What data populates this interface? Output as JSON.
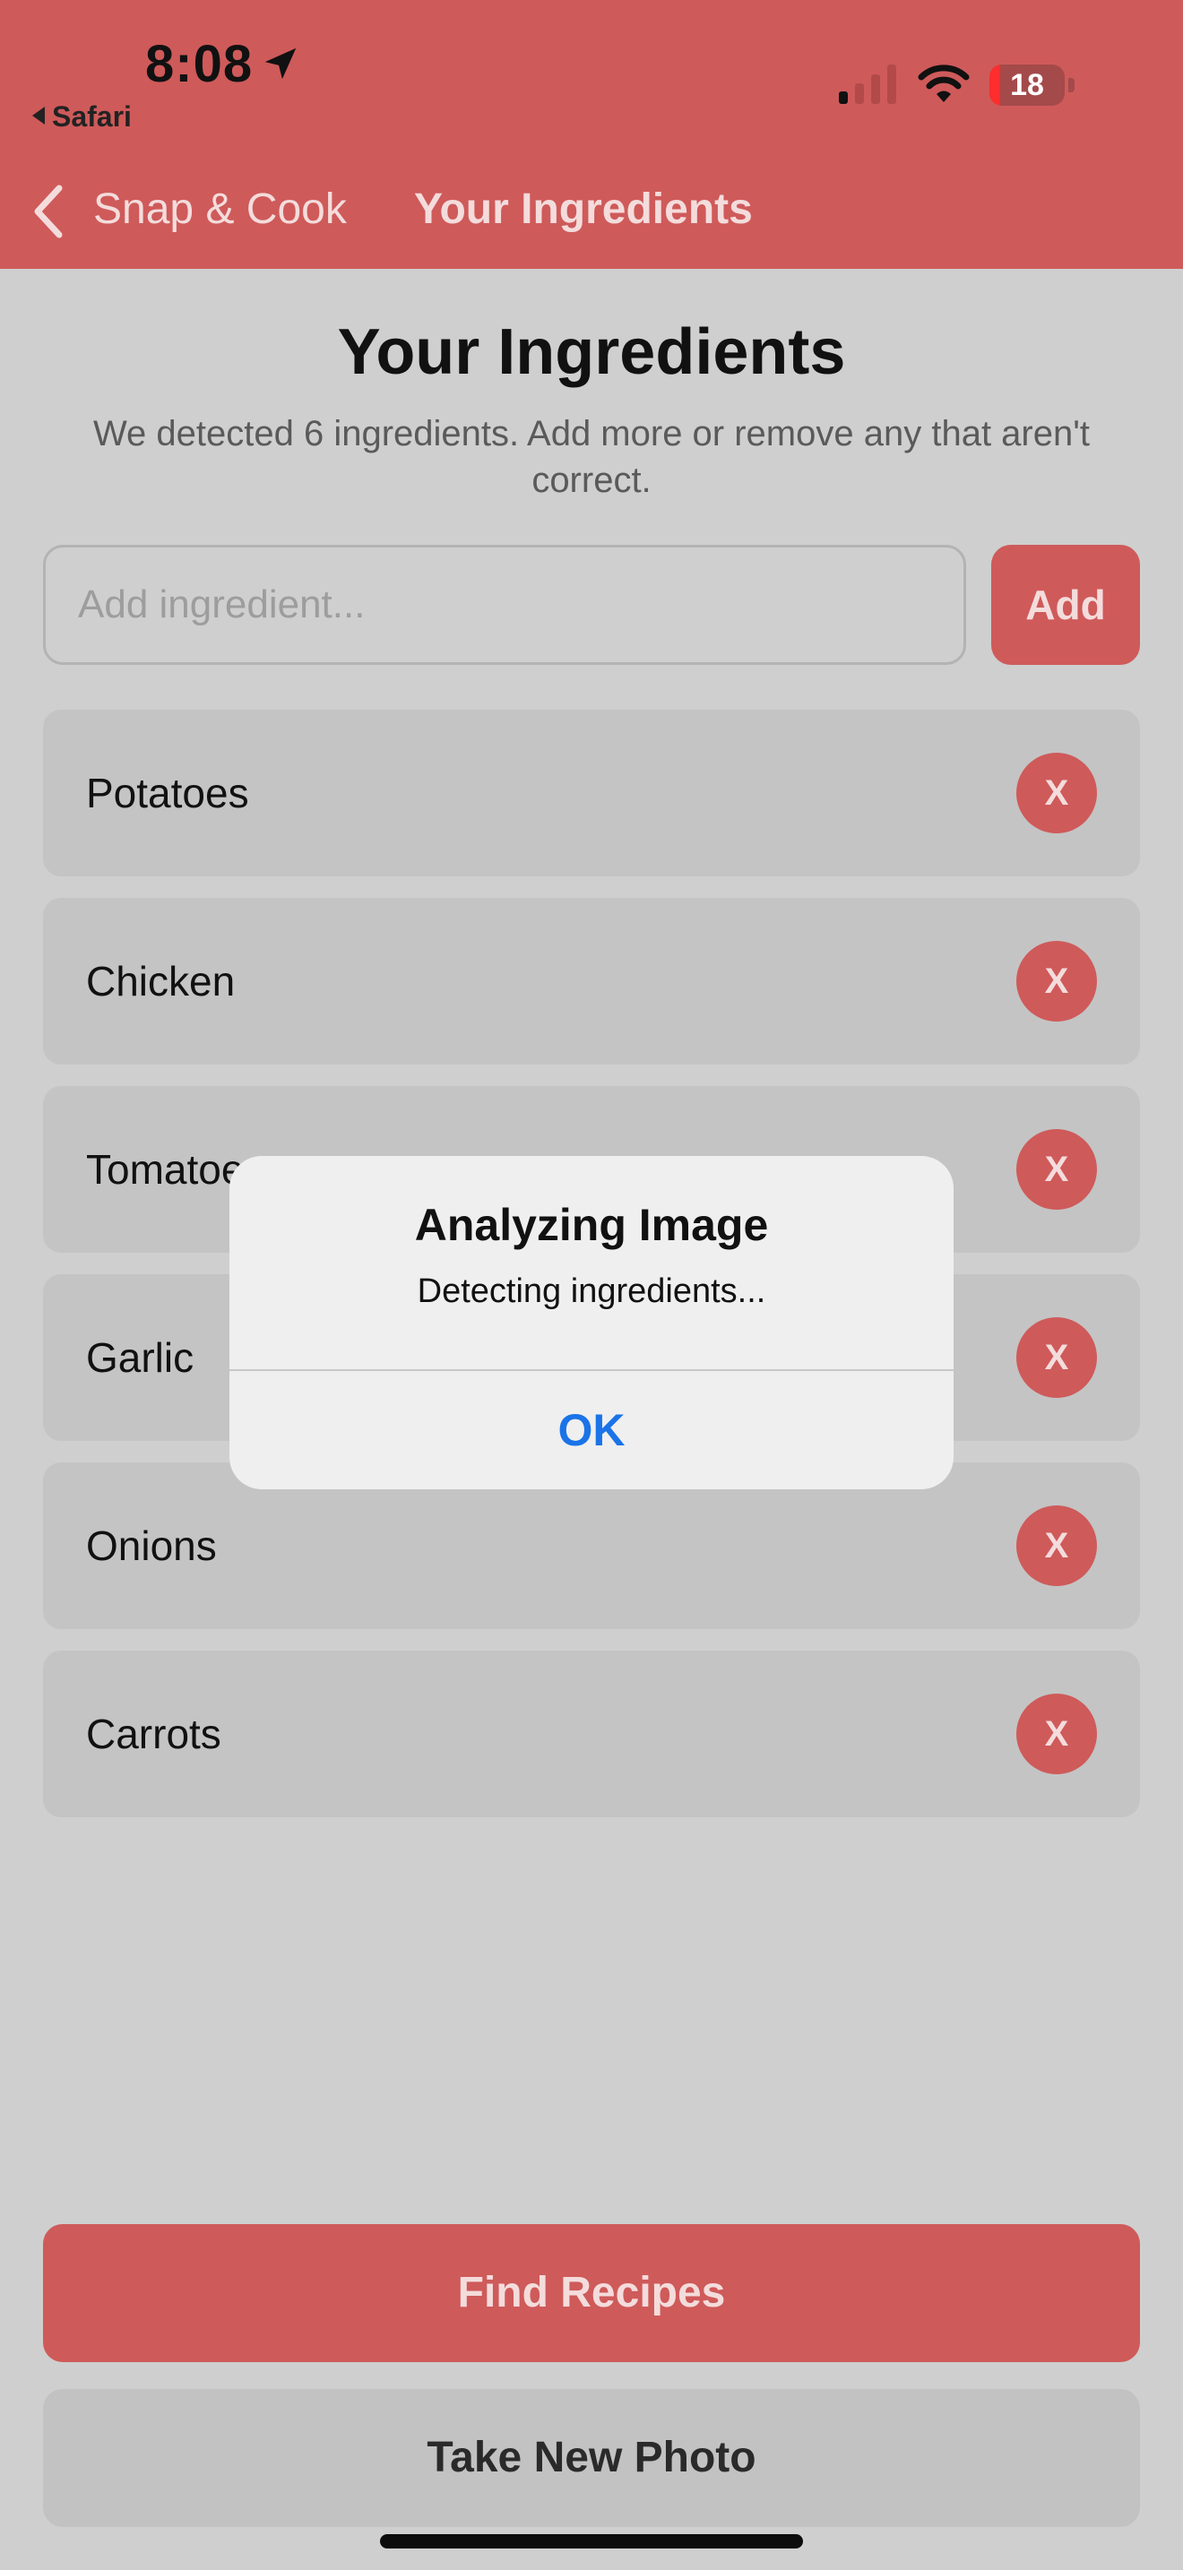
{
  "status_bar": {
    "time": "8:08",
    "back_app": "Safari",
    "battery": "18",
    "icons": [
      "location-arrow-icon",
      "cellular-signal-icon",
      "wifi-icon",
      "battery-icon"
    ]
  },
  "nav": {
    "back_label": "Snap & Cook",
    "title": "Your Ingredients",
    "back_icon": "chevron-left-icon"
  },
  "main": {
    "title": "Your Ingredients",
    "subtitle": "We detected 6 ingredients. Add more or remove any that aren't correct.",
    "input_placeholder": "Add ingredient...",
    "add_label": "Add",
    "remove_label": "X",
    "ingredients": [
      "Potatoes",
      "Chicken",
      "Tomatoes",
      "Garlic",
      "Onions",
      "Carrots"
    ]
  },
  "footer": {
    "find_recipes": "Find Recipes",
    "take_new_photo": "Take New Photo"
  },
  "alert": {
    "title": "Analyzing Image",
    "message": "Detecting ingredients...",
    "ok": "OK"
  },
  "colors": {
    "accent": "#cf5a5a",
    "background": "#cfcfcf",
    "alert_button": "#1a73e8"
  }
}
